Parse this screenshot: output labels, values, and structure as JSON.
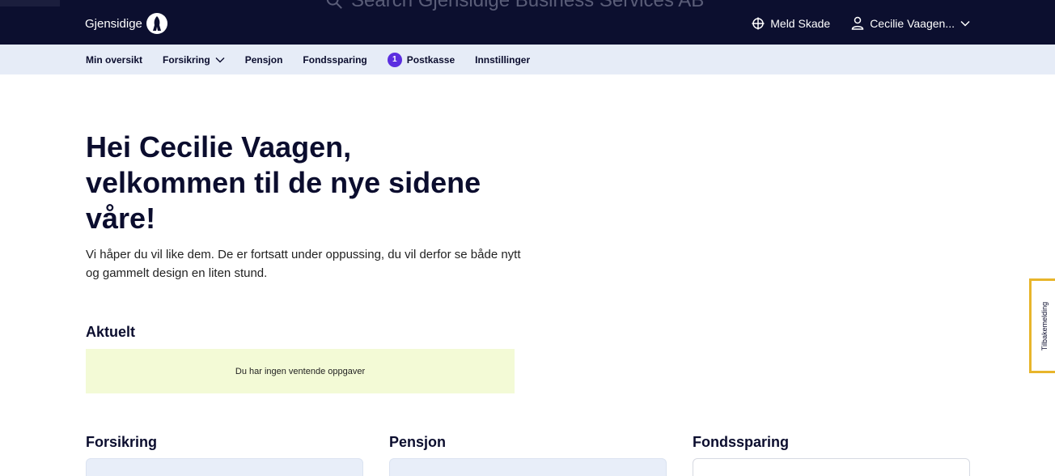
{
  "topbar": {
    "search_placeholder": "Search Gjensidige Business Services AB",
    "brand": "Gjensidige",
    "meld_skade": "Meld Skade",
    "user_name": "Cecilie Vaagen..."
  },
  "nav": {
    "items": [
      {
        "label": "Min oversikt"
      },
      {
        "label": "Forsikring"
      },
      {
        "label": "Pensjon"
      },
      {
        "label": "Fondssparing"
      },
      {
        "label": "Postkasse",
        "badge": "1"
      },
      {
        "label": "Innstillinger"
      }
    ]
  },
  "hero": {
    "title_line1": "Hei Cecilie Vaagen,",
    "title_line2": "velkommen til de nye sidene",
    "title_line3": "våre!",
    "subtitle": "Vi håper du vil like dem. De er fortsatt under oppussing, du vil derfor se både nytt og gammelt design en liten stund."
  },
  "aktuelt": {
    "title": "Aktuelt",
    "empty_message": "Du har ingen ventende oppgaver"
  },
  "columns": [
    {
      "title": "Forsikring"
    },
    {
      "title": "Pensjon"
    },
    {
      "title": "Fondssparing"
    }
  ],
  "feedback": {
    "label": "Tilbakemelding"
  },
  "colors": {
    "topbar_bg": "#0c0f2f",
    "subnav_bg": "#e6ecf7",
    "badge": "#5b2ee0",
    "aktuelt_bg": "#f3fad6",
    "feedback_border": "#e8b52b"
  },
  "icons": {
    "search": "search-icon",
    "logo": "gjensidige-logo-icon",
    "meld_skade": "crosshair-icon",
    "user": "user-icon",
    "chevron": "chevron-down-icon"
  }
}
